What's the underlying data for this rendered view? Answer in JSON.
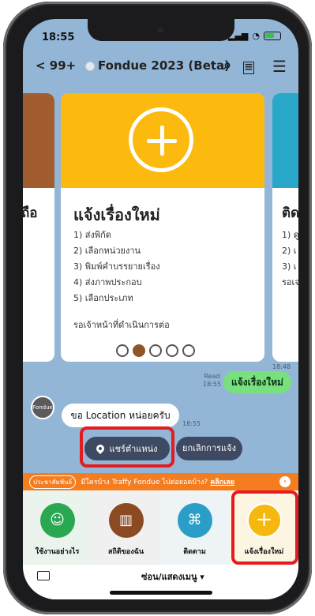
{
  "status": {
    "time": "18:55",
    "signal": "▂▄▆",
    "wifi": "wifi-icon"
  },
  "header": {
    "back": "< 99+",
    "title": "Fondue 2023 (Beta)"
  },
  "cards": {
    "left": {
      "heading": "ถือ"
    },
    "main": {
      "heading": "แจ้งเรื่องใหม่",
      "steps": [
        "1) ส่งพิกัด",
        "2) เลือกหน่วยงาน",
        "3) พิมพ์คำบรรยายเรื่อง",
        "4) ส่งภาพประกอบ",
        "5) เลือกประเภท"
      ],
      "waiting": "รอเจ้าหน้าที่ดำเนินการต่อ"
    },
    "right": {
      "heading": "ติด",
      "lines": [
        "1) ดู",
        "2) เ",
        "3) เ"
      ],
      "tail": "รอเจ"
    }
  },
  "chat": {
    "time_top": "18:48",
    "read": "Read",
    "read_time": "18:55",
    "user_message": "แจ้งเรื่องใหม่",
    "bot_avatar": "Fondue",
    "bot_message": "ขอ Location หน่อยครับ",
    "bot_time": "18:55",
    "quick_share": "แชร์ตำแหน่ง",
    "quick_cancel": "ยกเลิกการแจ้ง"
  },
  "promo": {
    "tag": "ประชาสัมพันธ์",
    "text": "มีใครบ้าง Traffy Fondue ไปต่อยอดบ้าง?",
    "link": "คลิกเลย"
  },
  "menu": [
    {
      "label": "ใช้งานอย่างไร",
      "color": "#29a851",
      "icon": "help-icon"
    },
    {
      "label": "สถิติของฉัน",
      "color": "#8b4a22",
      "icon": "chart-icon"
    },
    {
      "label": "ติดตาม",
      "color": "#2a9ec6",
      "icon": "flow-icon"
    },
    {
      "label": "แจ้งเรื่องใหม่",
      "color": "#f6b80e",
      "icon": "plus-icon"
    }
  ],
  "bottom": {
    "toggle": "ซ่อน/แสดงเมนู ▾"
  }
}
